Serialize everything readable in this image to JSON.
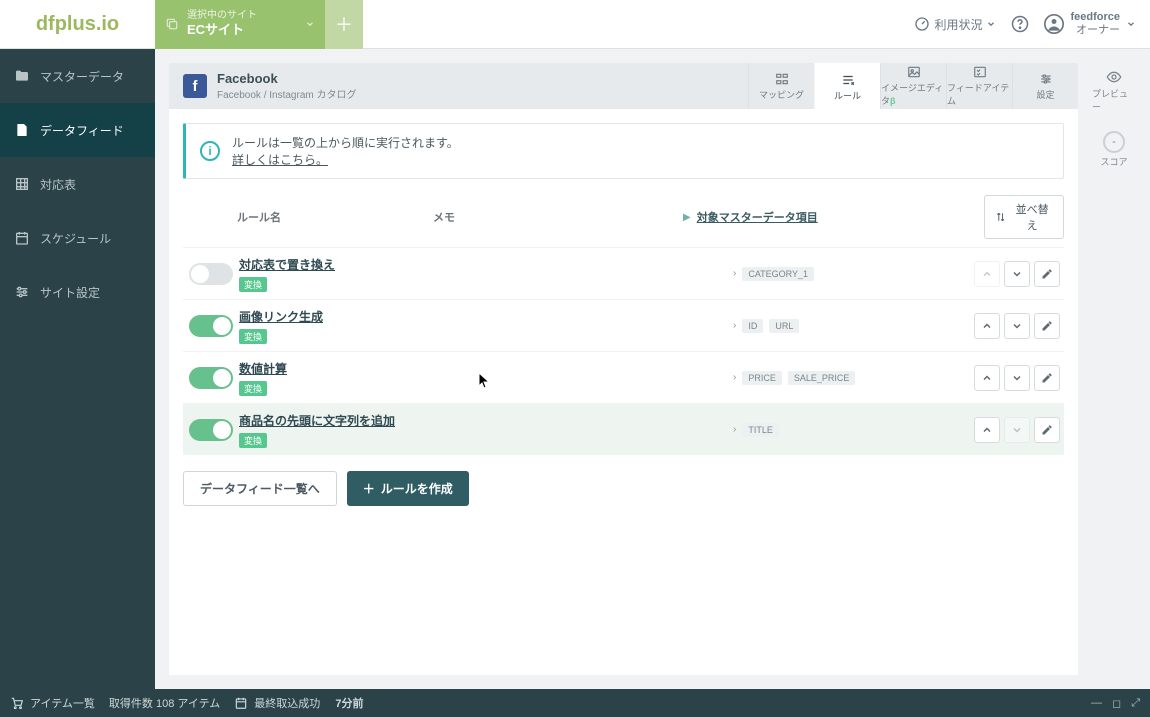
{
  "brand": "dfplus.io",
  "site_selector": {
    "label": "選択中のサイト",
    "name": "ECサイト"
  },
  "top": {
    "usage": "利用状況",
    "account": {
      "org": "feedforce",
      "role": "オーナー"
    }
  },
  "sidebar": {
    "items": [
      {
        "label": "マスターデータ"
      },
      {
        "label": "データフィード"
      },
      {
        "label": "対応表"
      },
      {
        "label": "スケジュール"
      },
      {
        "label": "サイト設定"
      }
    ]
  },
  "feed": {
    "title": "Facebook",
    "subtitle": "Facebook / Instagram カタログ",
    "tabs": [
      {
        "label": "マッピング"
      },
      {
        "label": "ルール"
      },
      {
        "label": "イメージエディタ",
        "beta": "β"
      },
      {
        "label": "フィードアイテム"
      },
      {
        "label": "設定"
      }
    ]
  },
  "rightcol": {
    "preview": "プレビュー",
    "score_label": "スコア",
    "score_value": "-"
  },
  "banner": {
    "line1": "ルールは一覧の上から順に実行されます。",
    "link": "詳しくはこちら。"
  },
  "columns": {
    "name": "ルール名",
    "memo": "メモ",
    "target": "対象マスターデータ項目",
    "sort": "並べ替え"
  },
  "rules": [
    {
      "enabled": false,
      "name": "対応表で置き換え",
      "tag": "変換",
      "targets": [
        "CATEGORY_1"
      ],
      "up_disabled": true,
      "down_disabled": false
    },
    {
      "enabled": true,
      "name": "画像リンク生成",
      "tag": "変換",
      "targets": [
        "ID",
        "URL"
      ],
      "up_disabled": false,
      "down_disabled": false
    },
    {
      "enabled": true,
      "name": "数値計算",
      "tag": "変換",
      "targets": [
        "PRICE",
        "SALE_PRICE"
      ],
      "up_disabled": false,
      "down_disabled": false
    },
    {
      "enabled": true,
      "name": "商品名の先頭に文字列を追加",
      "tag": "変換",
      "targets": [
        "TITLE"
      ],
      "up_disabled": false,
      "down_disabled": true,
      "hover": true
    }
  ],
  "footer": {
    "back": "データフィード一覧へ",
    "create": "ルールを作成"
  },
  "status": {
    "items_label": "アイテム一覧",
    "count_text": "取得件数 108 アイテム",
    "last_fetch": "最終取込成功",
    "last_time": "7分前"
  }
}
